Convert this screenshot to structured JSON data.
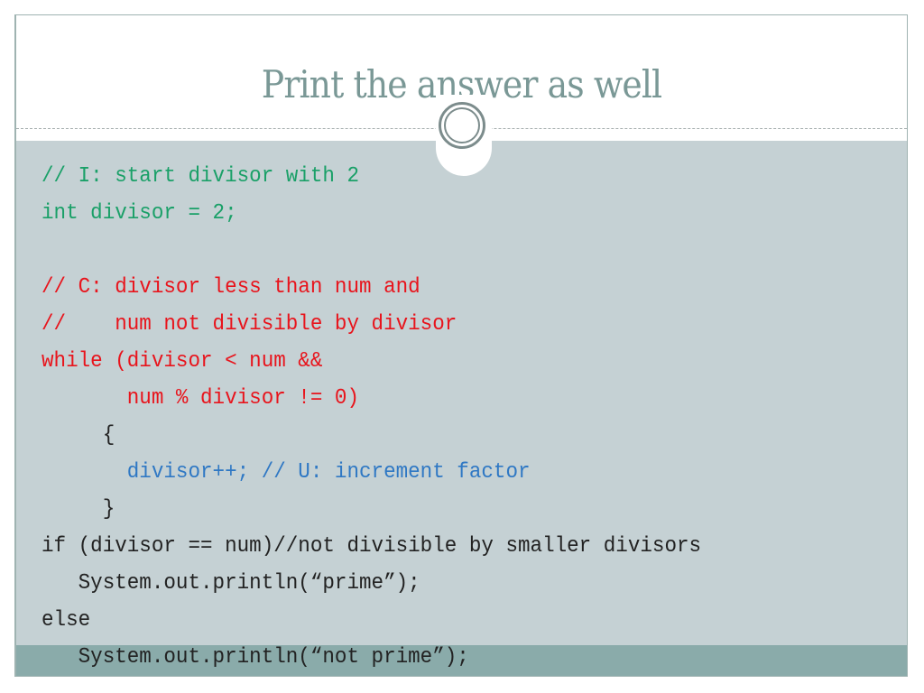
{
  "slide": {
    "title": "Print the answer as well",
    "code_lines": [
      {
        "text": "// I: start divisor with 2",
        "color": "green"
      },
      {
        "text": "int divisor = 2;",
        "color": "green"
      },
      {
        "text": "",
        "color": "green"
      },
      {
        "text": "// C: divisor less than num and",
        "color": "red"
      },
      {
        "text": "//    num not divisible by divisor",
        "color": "red"
      },
      {
        "text": "while (divisor < num &&",
        "color": "red"
      },
      {
        "text": "       num % divisor != 0)",
        "color": "red"
      },
      {
        "text": "     {",
        "color": "dark"
      },
      {
        "text": "       divisor++; // U: increment factor",
        "color": "blue"
      },
      {
        "text": "     }",
        "color": "dark"
      },
      {
        "text": "if (divisor == num)//not divisible by smaller divisors",
        "color": "dark"
      },
      {
        "text": "   System.out.println(“prime”);",
        "color": "dark"
      },
      {
        "text": "else",
        "color": "dark"
      },
      {
        "text": "   System.out.println(“not prime”);",
        "color": "dark"
      }
    ]
  },
  "colors": {
    "title": "#7a9896",
    "content_band": "#c5d1d4",
    "bottom_band": "#8aabaa",
    "green": "#1aa068",
    "red": "#e8141c",
    "blue": "#2f78c4",
    "dark": "#222222"
  }
}
